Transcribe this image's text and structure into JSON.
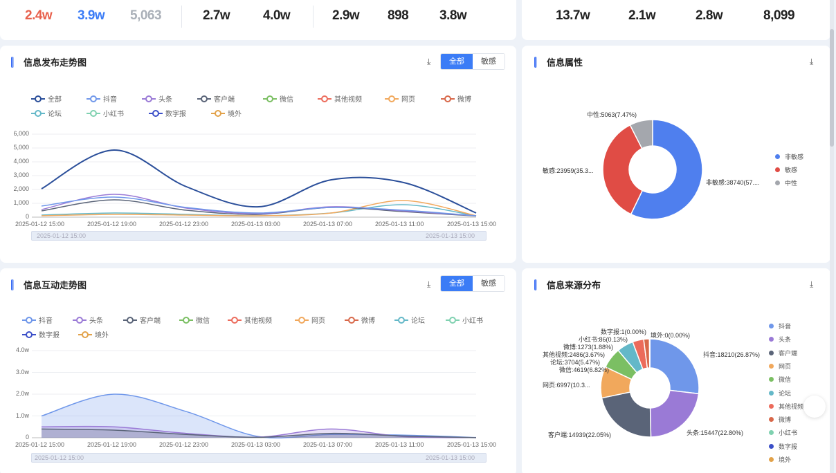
{
  "stats": {
    "left": [
      "2.4w",
      "3.9w",
      "5,063",
      "2.7w",
      "4.0w",
      "2.9w",
      "898",
      "3.8w"
    ],
    "right": [
      "13.7w",
      "2.1w",
      "2.8w",
      "8,099"
    ],
    "colors": {
      "red": "#e8604c",
      "blue": "#3b7cf6",
      "gray": "#aab0b8",
      "dark": "#222222"
    }
  },
  "trend": {
    "title": "信息发布走势图",
    "toggle": [
      "全部",
      "敏感"
    ],
    "legend": [
      {
        "name": "全部",
        "color": "#2b4f9a"
      },
      {
        "name": "抖音",
        "color": "#6f97ea"
      },
      {
        "name": "头条",
        "color": "#9a7ad6"
      },
      {
        "name": "客户端",
        "color": "#5a6478"
      },
      {
        "name": "微信",
        "color": "#7bbf63"
      },
      {
        "name": "其他视频",
        "color": "#ec6b5b"
      },
      {
        "name": "网页",
        "color": "#f1a85c"
      },
      {
        "name": "微博",
        "color": "#d8684a"
      },
      {
        "name": "论坛",
        "color": "#64b8c8"
      },
      {
        "name": "小红书",
        "color": "#7fd1b0"
      },
      {
        "name": "数字报",
        "color": "#3b4fc8"
      },
      {
        "name": "境外",
        "color": "#e2a24a"
      }
    ],
    "yticks": [
      "6,000",
      "5,000",
      "4,000",
      "3,000",
      "2,000",
      "1,000",
      "0"
    ],
    "xticks": [
      "2025-01-12 15:00",
      "2025-01-12 19:00",
      "2025-01-12 23:00",
      "2025-01-13 03:00",
      "2025-01-13 07:00",
      "2025-01-13 11:00",
      "2025-01-13 15:00"
    ],
    "zoom": {
      "start": "2025-01-12 15:00",
      "end": "2025-01-13 15:00"
    }
  },
  "attr": {
    "title": "信息属性",
    "labels": {
      "neutral": "中性:5063(7.47%)",
      "sensitive": "敏感:23959(35.3...",
      "nonsensitive": "非敏感:38740(57...."
    },
    "legend": [
      {
        "name": "非敏感",
        "color": "#4f7fee"
      },
      {
        "name": "敏感",
        "color": "#e04c45"
      },
      {
        "name": "中性",
        "color": "#a4a7ad"
      }
    ]
  },
  "interact": {
    "title": "信息互动走势图",
    "toggle": [
      "全部",
      "敏感"
    ],
    "legend": [
      {
        "name": "抖音",
        "color": "#6f97ea"
      },
      {
        "name": "头条",
        "color": "#9a7ad6"
      },
      {
        "name": "客户端",
        "color": "#5a6478"
      },
      {
        "name": "微信",
        "color": "#7bbf63"
      },
      {
        "name": "其他视频",
        "color": "#ec6b5b"
      },
      {
        "name": "网页",
        "color": "#f1a85c"
      },
      {
        "name": "微博",
        "color": "#d8684a"
      },
      {
        "name": "论坛",
        "color": "#64b8c8"
      },
      {
        "name": "小红书",
        "color": "#7fd1b0"
      },
      {
        "name": "数字报",
        "color": "#3b4fc8"
      },
      {
        "name": "境外",
        "color": "#e2a24a"
      }
    ],
    "yticks": [
      "4.0w",
      "3.0w",
      "2.0w",
      "1.0w",
      "0"
    ],
    "xticks": [
      "2025-01-12 15:00",
      "2025-01-12 19:00",
      "2025-01-12 23:00",
      "2025-01-13 03:00",
      "2025-01-13 07:00",
      "2025-01-13 11:00",
      "2025-01-13 15:00"
    ],
    "zoom": {
      "start": "2025-01-12 15:00",
      "end": "2025-01-13 15:00"
    }
  },
  "source": {
    "title": "信息来源分布",
    "labels": {
      "douyin": "抖音:18210(26.87%)",
      "toutiao": "头条:15447(22.80%)",
      "kehuduan": "客户端:14939(22.05%)",
      "wangye": "网页:6997(10.3...",
      "weixin": "微信:4619(6.82%)",
      "luntan": "论坛:3704(5.47%)",
      "qita": "其他视频:2486(3.67%)",
      "weibo": "微博:1273(1.88%)",
      "xhs": "小红书:86(0.13%)",
      "szb": "数字报:1(0.00%)",
      "jingwai": "境外:0(0.00%)"
    },
    "legend": [
      {
        "name": "抖音",
        "color": "#6f97ea"
      },
      {
        "name": "头条",
        "color": "#9a7ad6"
      },
      {
        "name": "客户端",
        "color": "#5a6478"
      },
      {
        "name": "网页",
        "color": "#f1a85c"
      },
      {
        "name": "微信",
        "color": "#7bbf63"
      },
      {
        "name": "论坛",
        "color": "#64b8c8"
      },
      {
        "name": "其他视频",
        "color": "#ec6b5b"
      },
      {
        "name": "微博",
        "color": "#d8684a"
      },
      {
        "name": "小红书",
        "color": "#7fd1b0"
      },
      {
        "name": "数字报",
        "color": "#3b4fc8"
      },
      {
        "name": "境外",
        "color": "#e2a24a"
      }
    ]
  },
  "chart_data": [
    {
      "type": "line",
      "x": [
        "2025-01-12 15:00",
        "2025-01-12 19:00",
        "2025-01-12 23:00",
        "2025-01-13 03:00",
        "2025-01-13 07:00",
        "2025-01-13 11:00",
        "2025-01-13 15:00"
      ],
      "ylim": [
        0,
        6000
      ],
      "series": [
        {
          "name": "全部",
          "values": [
            2050,
            4850,
            2200,
            750,
            2700,
            2500,
            300
          ]
        },
        {
          "name": "抖音",
          "values": [
            800,
            1450,
            700,
            300,
            700,
            500,
            100
          ]
        },
        {
          "name": "头条",
          "values": [
            550,
            1650,
            650,
            250,
            750,
            450,
            100
          ]
        },
        {
          "name": "客户端",
          "values": [
            450,
            1250,
            500,
            200,
            700,
            400,
            80
          ]
        },
        {
          "name": "网页",
          "values": [
            100,
            200,
            150,
            100,
            300,
            1200,
            100
          ]
        },
        {
          "name": "论坛",
          "values": [
            150,
            300,
            200,
            100,
            300,
            900,
            100
          ]
        }
      ]
    },
    {
      "type": "pie",
      "values": [
        {
          "label": "非敏感",
          "value": 38740,
          "pct": "57...."
        },
        {
          "label": "敏感",
          "value": 23959,
          "pct": "35.3..."
        },
        {
          "label": "中性",
          "value": 5063,
          "pct": "7.47%"
        }
      ]
    },
    {
      "type": "area",
      "x": [
        "2025-01-12 15:00",
        "2025-01-12 19:00",
        "2025-01-12 23:00",
        "2025-01-13 03:00",
        "2025-01-13 07:00",
        "2025-01-13 11:00",
        "2025-01-13 15:00"
      ],
      "ylim": [
        0,
        40000
      ],
      "series": [
        {
          "name": "抖音",
          "values": [
            10000,
            20000,
            12000,
            500,
            1500,
            1200,
            100
          ]
        },
        {
          "name": "头条",
          "values": [
            5000,
            5000,
            2000,
            300,
            4000,
            500,
            50
          ]
        },
        {
          "name": "客户端",
          "values": [
            4000,
            3500,
            1500,
            200,
            2000,
            800,
            50
          ]
        }
      ]
    },
    {
      "type": "pie",
      "values": [
        {
          "label": "抖音",
          "value": 18210,
          "pct": "26.87%"
        },
        {
          "label": "头条",
          "value": 15447,
          "pct": "22.80%"
        },
        {
          "label": "客户端",
          "value": 14939,
          "pct": "22.05%"
        },
        {
          "label": "网页",
          "value": 6997,
          "pct": "10.3..."
        },
        {
          "label": "微信",
          "value": 4619,
          "pct": "6.82%"
        },
        {
          "label": "论坛",
          "value": 3704,
          "pct": "5.47%"
        },
        {
          "label": "其他视频",
          "value": 2486,
          "pct": "3.67%"
        },
        {
          "label": "微博",
          "value": 1273,
          "pct": "1.88%"
        },
        {
          "label": "小红书",
          "value": 86,
          "pct": "0.13%"
        },
        {
          "label": "数字报",
          "value": 1,
          "pct": "0.00%"
        },
        {
          "label": "境外",
          "value": 0,
          "pct": "0.00%"
        }
      ]
    }
  ]
}
